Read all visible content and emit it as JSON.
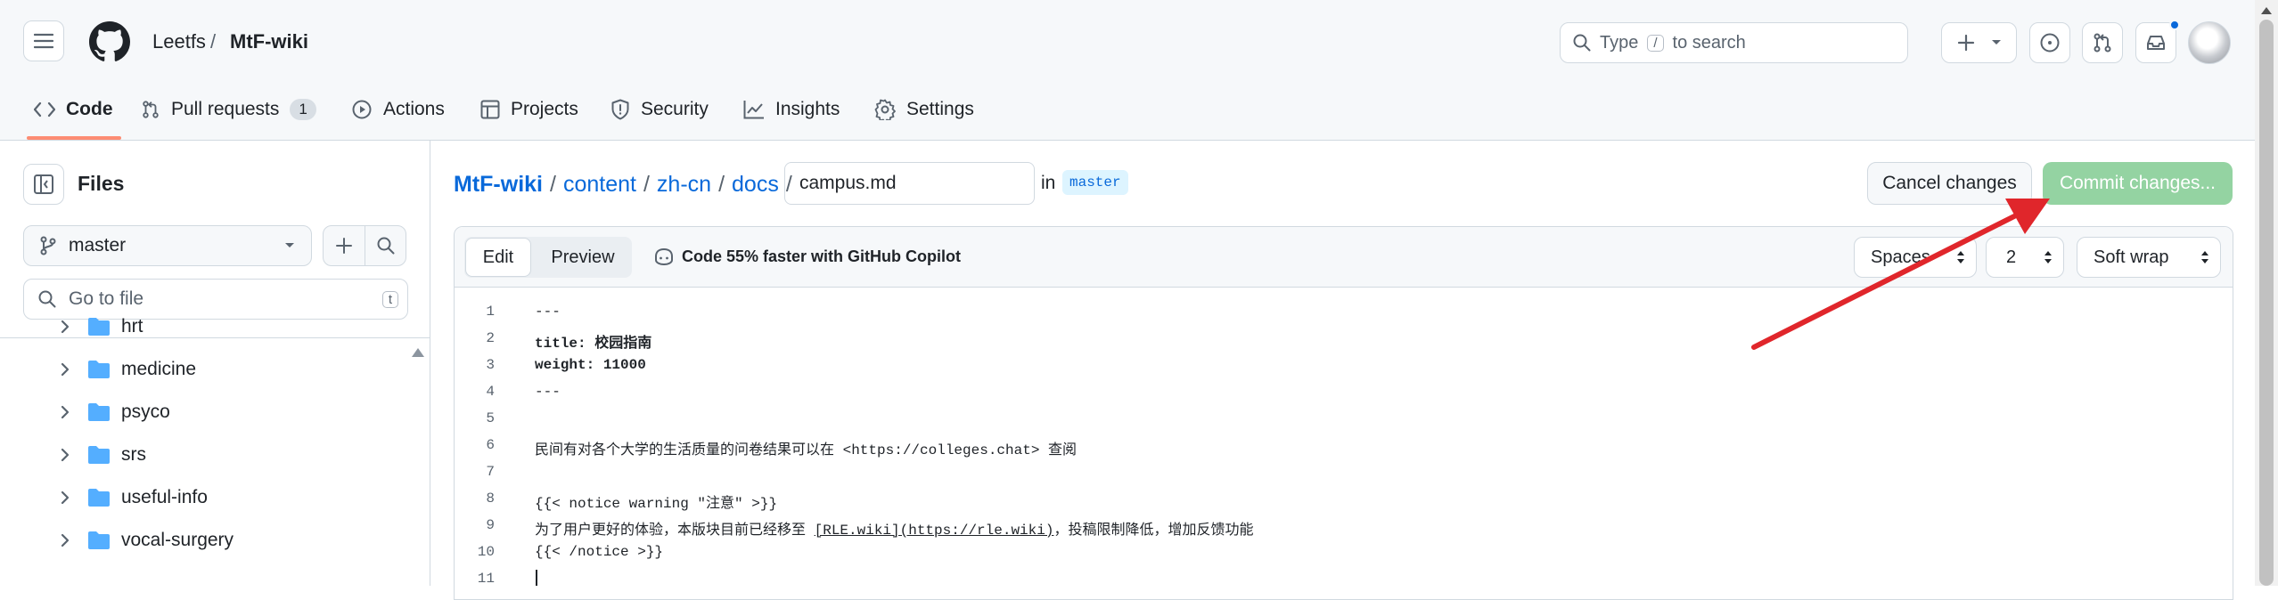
{
  "header": {
    "owner": "Leetfs",
    "separator": "/",
    "repo": "MtF-wiki",
    "search_placeholder_pre": "Type",
    "search_key": "/",
    "search_placeholder_post": "to search",
    "tabs": [
      {
        "label": "Code"
      },
      {
        "label": "Pull requests",
        "count": "1"
      },
      {
        "label": "Actions"
      },
      {
        "label": "Projects"
      },
      {
        "label": "Security"
      },
      {
        "label": "Insights"
      },
      {
        "label": "Settings"
      }
    ]
  },
  "sidebar": {
    "title": "Files",
    "branch": "master",
    "goto_placeholder": "Go to file",
    "goto_key": "t",
    "folders": [
      "hrt",
      "medicine",
      "psyco",
      "srs",
      "useful-info",
      "vocal-surgery"
    ]
  },
  "editor": {
    "path": [
      "MtF-wiki",
      "content",
      "zh-cn",
      "docs"
    ],
    "filename": "campus.md",
    "in_label": "in",
    "branch": "master",
    "cancel_label": "Cancel changes",
    "commit_label": "Commit changes...",
    "tab_edit": "Edit",
    "tab_preview": "Preview",
    "copilot_label": "Code 55% faster with GitHub Copilot",
    "indent_mode": "Spaces",
    "indent_size": "2",
    "wrap_mode": "Soft wrap",
    "lines": [
      {
        "n": "1",
        "text": "---"
      },
      {
        "n": "2",
        "text": "title: 校园指南"
      },
      {
        "n": "3",
        "text": "weight: 11000"
      },
      {
        "n": "4",
        "text": "---"
      },
      {
        "n": "5",
        "text": ""
      },
      {
        "n": "6",
        "text": "民间有对各个大学的生活质量的问卷结果可以在 <https://colleges.chat> 查阅"
      },
      {
        "n": "7",
        "text": ""
      },
      {
        "n": "8",
        "text": "{{< notice warning \"注意\" >}}"
      },
      {
        "n": "9",
        "pre": "为了用户更好的体验，本版块目前已经移至 ",
        "link": "[RLE.wiki](https://rle.wiki)",
        "post": "，投稿限制降低，增加反馈功能"
      },
      {
        "n": "10",
        "text": "{{< /notice >}}"
      },
      {
        "n": "11",
        "text": ""
      }
    ]
  },
  "colors": {
    "accent_link": "#0969da",
    "commit_button": "#94d3a2",
    "arrow": "#e0262b"
  }
}
